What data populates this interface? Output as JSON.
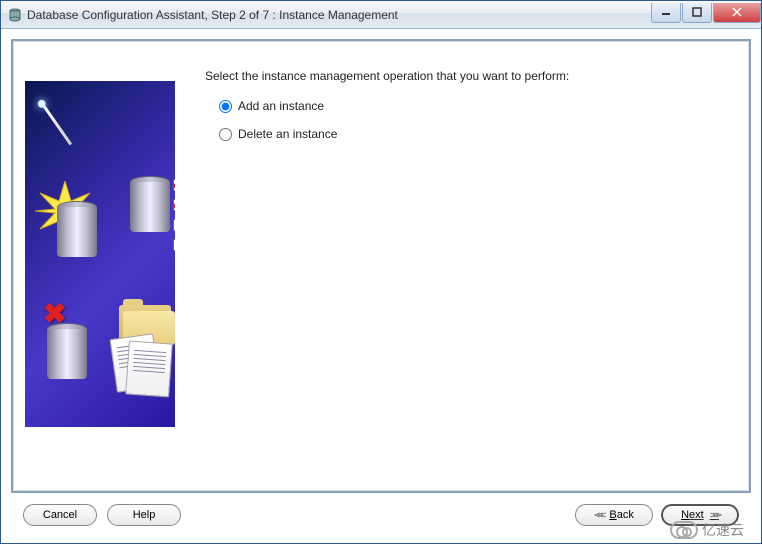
{
  "window": {
    "title": "Database Configuration Assistant, Step 2 of 7 : Instance Management"
  },
  "content": {
    "instruction": "Select the instance management operation that you want to perform:",
    "options": [
      {
        "label": "Add an instance",
        "selected": true
      },
      {
        "label": "Delete an instance",
        "selected": false
      }
    ]
  },
  "buttons": {
    "cancel": "Cancel",
    "help": "Help",
    "back_prefix": "B",
    "back_rest": "ack",
    "next_prefix": "N",
    "next_rest": "ext"
  },
  "watermark": "亿速云"
}
